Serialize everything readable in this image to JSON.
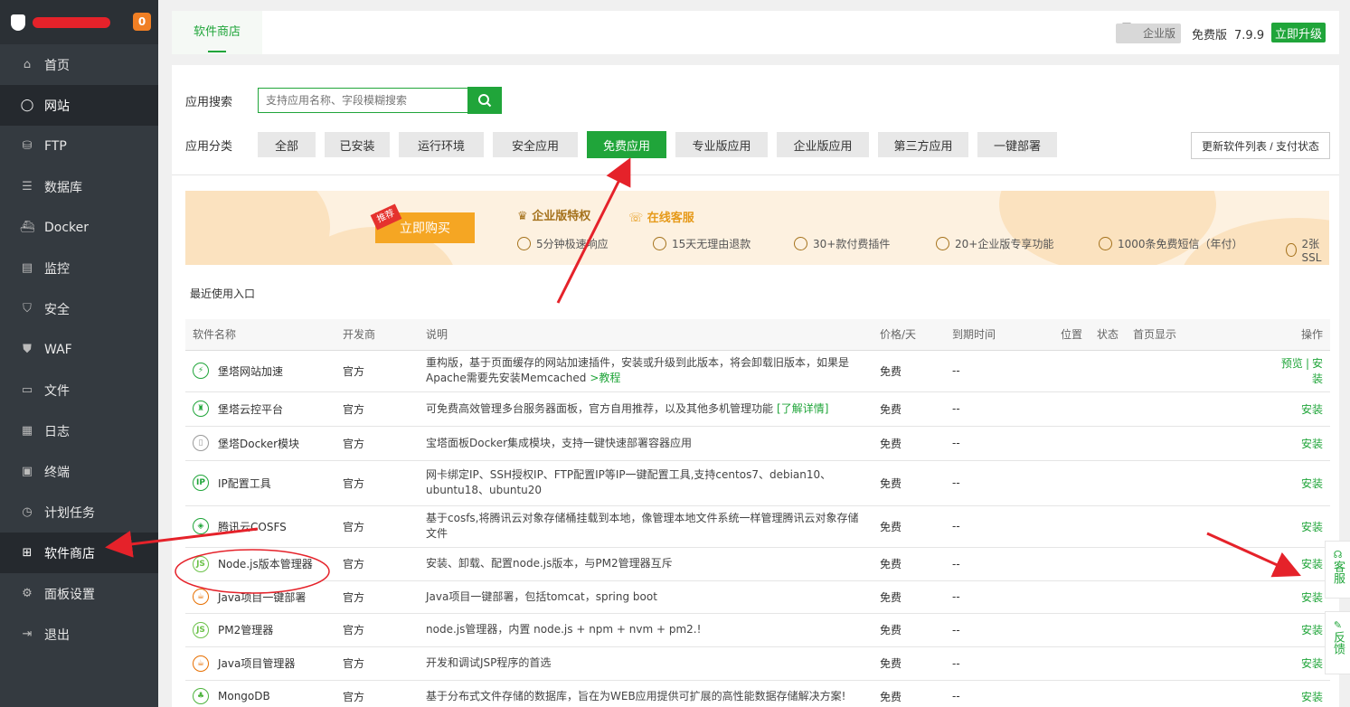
{
  "sidebar": {
    "badge": "0",
    "items": [
      {
        "label": "首页",
        "icon": "home-icon"
      },
      {
        "label": "网站",
        "icon": "globe-icon"
      },
      {
        "label": "FTP",
        "icon": "ftp-icon"
      },
      {
        "label": "数据库",
        "icon": "database-icon"
      },
      {
        "label": "Docker",
        "icon": "docker-icon"
      },
      {
        "label": "监控",
        "icon": "monitor-icon"
      },
      {
        "label": "安全",
        "icon": "shield-icon"
      },
      {
        "label": "WAF",
        "icon": "waf-icon"
      },
      {
        "label": "文件",
        "icon": "folder-icon"
      },
      {
        "label": "日志",
        "icon": "log-icon"
      },
      {
        "label": "终端",
        "icon": "terminal-icon"
      },
      {
        "label": "计划任务",
        "icon": "clock-icon"
      },
      {
        "label": "软件商店",
        "icon": "grid-icon"
      },
      {
        "label": "面板设置",
        "icon": "gear-icon"
      },
      {
        "label": "退出",
        "icon": "exit-icon"
      }
    ]
  },
  "topbar": {
    "tab": "软件商店",
    "enterprise": "企业版",
    "free_label": "免费版",
    "version": "7.9.9",
    "upgrade": "立即升级"
  },
  "search": {
    "label": "应用搜索",
    "placeholder": "支持应用名称、字段模糊搜索"
  },
  "categories": {
    "label": "应用分类",
    "items": [
      "全部",
      "已安装",
      "运行环境",
      "安全应用",
      "免费应用",
      "专业版应用",
      "企业版应用",
      "第三方应用",
      "一键部署"
    ],
    "selected": "免费应用",
    "refresh": "更新软件列表 / 支付状态"
  },
  "banner": {
    "tag": "推荐",
    "buy": "立即购买",
    "title": "企业版特权",
    "service": "在线客服",
    "features": [
      "5分钟极速响应",
      "15天无理由退款",
      "30+款付费插件",
      "20+企业版专享功能",
      "1000条免费短信（年付）",
      "2张SSL"
    ]
  },
  "recent": "最近使用入口",
  "table": {
    "headers": [
      "软件名称",
      "开发商",
      "说明",
      "价格/天",
      "到期时间",
      "位置",
      "状态",
      "首页显示",
      "操作"
    ],
    "rows": [
      {
        "name": "堡塔网站加速",
        "dev": "官方",
        "desc": "重构版，基于页面缓存的网站加速插件，安装或升级到此版本，将会卸载旧版本，如果是Apache需要先安装Memcached",
        "desc_link": ">教程",
        "price": "免费",
        "expire": "--",
        "preview": "预览",
        "sep": "|",
        "op": "安装",
        "icon": "bolt-icon",
        "color": "#20a53a"
      },
      {
        "name": "堡塔云控平台",
        "dev": "官方",
        "desc": "可免费高效管理多台服务器面板，官方自用推荐，以及其他多机管理功能",
        "desc_link": "[了解详情]",
        "price": "免费",
        "expire": "--",
        "op": "安装",
        "icon": "tower-icon",
        "color": "#20a53a"
      },
      {
        "name": "堡塔Docker模块",
        "dev": "官方",
        "desc": "宝塔面板Docker集成模块，支持一键快速部署容器应用",
        "price": "免费",
        "expire": "--",
        "op": "安装",
        "icon": "docker-module-icon",
        "color": "#999"
      },
      {
        "name": "IP配置工具",
        "dev": "官方",
        "desc": "网卡绑定IP、SSH授权IP、FTP配置IP等IP一键配置工具,支持centos7、debian10、ubuntu18、ubuntu20",
        "price": "免费",
        "expire": "--",
        "op": "安装",
        "icon": "ip-icon",
        "color": "#20a53a"
      },
      {
        "name": "腾讯云COSFS",
        "dev": "官方",
        "desc": "基于cosfs,将腾讯云对象存储桶挂载到本地，像管理本地文件系统一样管理腾讯云对象存储文件",
        "price": "免费",
        "expire": "--",
        "op": "安装",
        "icon": "cosfs-icon",
        "color": "#20a53a"
      },
      {
        "name": "Node.js版本管理器",
        "dev": "官方",
        "desc": "安装、卸载、配置node.js版本，与PM2管理器互斥",
        "price": "免费",
        "expire": "--",
        "op": "安装",
        "icon": "nodejs-icon",
        "color": "#6cc24a"
      },
      {
        "name": "Java项目一键部署",
        "dev": "官方",
        "desc": "Java项目一键部署，包括tomcat，spring boot",
        "price": "免费",
        "expire": "--",
        "op": "安装",
        "icon": "java-icon",
        "color": "#e76f00"
      },
      {
        "name": "PM2管理器",
        "dev": "官方",
        "desc": "node.js管理器，内置 node.js + npm + nvm + pm2.!",
        "price": "免费",
        "expire": "--",
        "op": "安装",
        "icon": "nodejs-icon",
        "color": "#6cc24a"
      },
      {
        "name": "Java项目管理器",
        "dev": "官方",
        "desc": "开发和调试JSP程序的首选",
        "price": "免费",
        "expire": "--",
        "op": "安装",
        "icon": "java-icon",
        "color": "#e76f00"
      },
      {
        "name": "MongoDB",
        "dev": "官方",
        "desc": "基于分布式文件存储的数据库，旨在为WEB应用提供可扩展的高性能数据存储解决方案!",
        "price": "免费",
        "expire": "--",
        "op": "安装",
        "icon": "mongodb-icon",
        "color": "#4db33d"
      }
    ]
  },
  "float": {
    "service": "客服",
    "feedback": "反馈"
  },
  "colors": {
    "accent": "#20a53a",
    "sidebar": "#343a40",
    "annotation": "#e5222a"
  }
}
